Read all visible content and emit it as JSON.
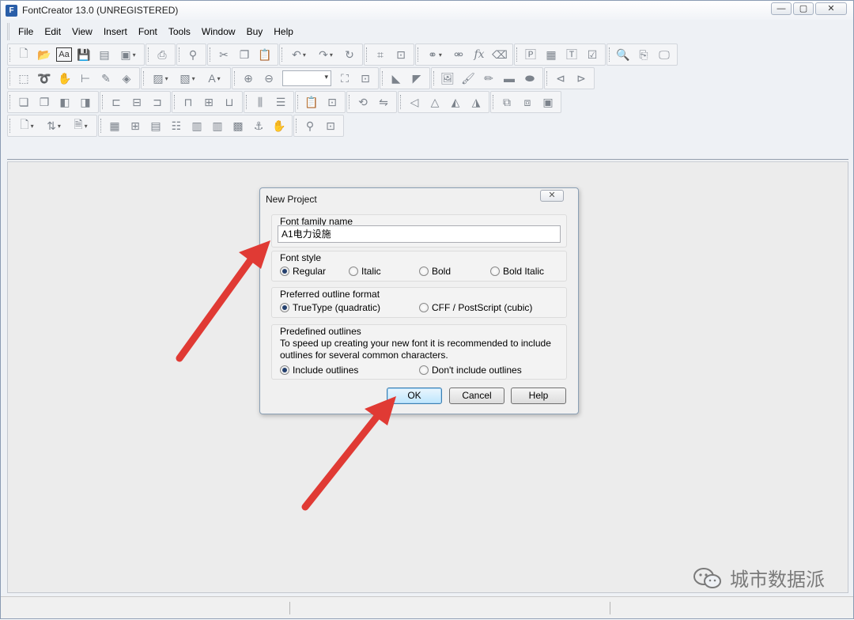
{
  "window": {
    "title": "FontCreator 13.0 (UNREGISTERED)",
    "app_icon": "F",
    "controls": {
      "minimize": "—",
      "maximize": "▢",
      "close": "✕"
    }
  },
  "menu": [
    "File",
    "Edit",
    "View",
    "Insert",
    "Font",
    "Tools",
    "Window",
    "Buy",
    "Help"
  ],
  "toolbar_icons": {
    "row1": [
      "new-font-icon",
      "open-icon",
      "font-preview-icon",
      "save-icon",
      "save-all-icon",
      "save-dropdown-icon",
      "print-icon",
      "find-icon",
      "cut-icon",
      "copy-icon",
      "paste-icon",
      "undo-icon",
      "redo-icon",
      "refresh-icon",
      "insert-character-icon",
      "insert-glyph-icon",
      "link-icon",
      "unlink-icon",
      "function-icon",
      "eraser-icon",
      "font-properties-icon",
      "test-icon",
      "transform-icon",
      "validate-icon",
      "search-glyph-icon",
      "search-replace-icon",
      "preview-icon"
    ],
    "row2": [
      "select-rect-icon",
      "lasso-icon",
      "hand-icon",
      "measure-icon",
      "pen-icon",
      "fill-icon",
      "image-icon",
      "pattern-icon",
      "text-icon",
      "zoom-in-icon",
      "zoom-out-icon",
      "zoom-fit-icon",
      "zoom-select-icon",
      "point-icon",
      "add-point-icon",
      "image-add-icon",
      "brush-icon",
      "pencil-icon",
      "rectangle-icon",
      "ellipse-icon",
      "back-icon",
      "forward-icon"
    ],
    "row3": [
      "group-icon",
      "ungroup-icon",
      "front-icon",
      "back-layer-icon",
      "align-left-icon",
      "align-center-icon",
      "align-right-icon",
      "align-top-icon",
      "align-middle-icon",
      "align-bottom-icon",
      "distribute-h-icon",
      "distribute-v-icon",
      "clipboard-icon",
      "glyph-copy-icon",
      "rotate-icon",
      "flip-icon",
      "skew-left-icon",
      "skew-center-icon",
      "skew-right-icon",
      "skew-all-icon",
      "union-icon",
      "intersect-icon",
      "subtract-icon"
    ],
    "row4": [
      "page-icon",
      "sort-icon",
      "document-icon",
      "grid-icon",
      "grid-add-icon",
      "grid-remove-icon",
      "list-icon",
      "table-icon",
      "columns-icon",
      "table-edit-icon",
      "anchor-icon",
      "hand-lock-icon",
      "node-icon",
      "glyph-map-icon"
    ]
  },
  "dialog": {
    "title": "New Project",
    "close": "✕",
    "font_family_label": "Font family name",
    "font_family_value": "A1电力设施",
    "font_style_label": "Font style",
    "font_styles": [
      {
        "label": "Regular",
        "checked": true
      },
      {
        "label": "Italic",
        "checked": false
      },
      {
        "label": "Bold",
        "checked": false
      },
      {
        "label": "Bold Italic",
        "checked": false
      }
    ],
    "outline_label": "Preferred outline format",
    "outline_formats": [
      {
        "label": "TrueType (quadratic)",
        "checked": true
      },
      {
        "label": "CFF / PostScript (cubic)",
        "checked": false
      }
    ],
    "predefined_label": "Predefined outlines",
    "predefined_desc": "To speed up creating your new font it is recommended to include outlines for several common characters.",
    "predefined_options": [
      {
        "label": "Include outlines",
        "checked": true
      },
      {
        "label": "Don't include outlines",
        "checked": false
      }
    ],
    "ok": "OK",
    "cancel": "Cancel",
    "help": "Help"
  },
  "watermark": {
    "text": "城市数据派"
  },
  "colors": {
    "arrow": "#e03a34",
    "accent": "#3c7fb1"
  }
}
